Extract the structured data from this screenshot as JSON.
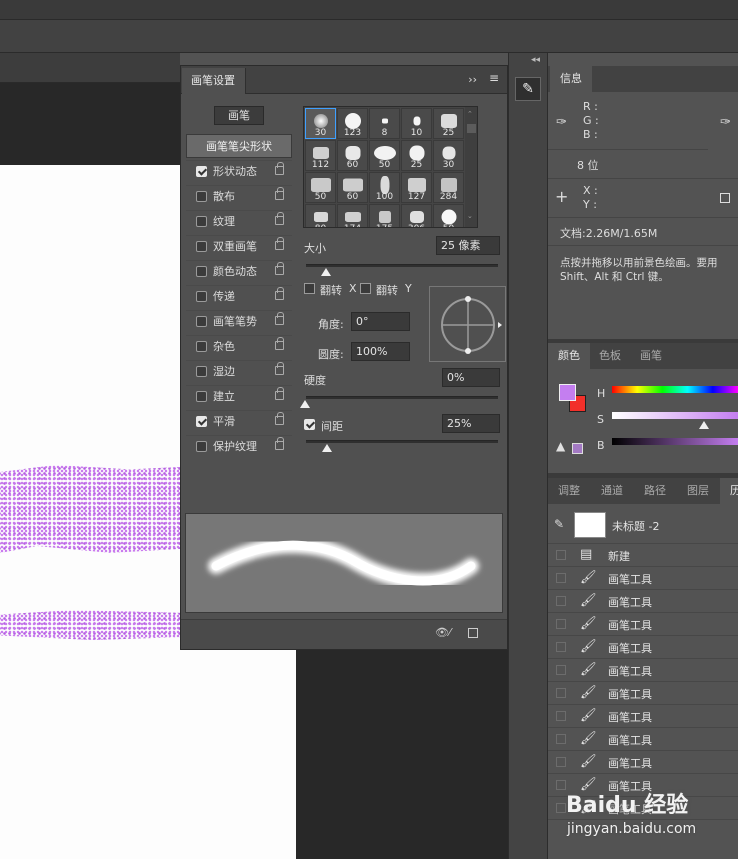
{
  "brush_panel": {
    "tab": "画笔设置",
    "brush_button": "画笔",
    "tip_shape_header": "画笔笔尖形状",
    "options": [
      {
        "label": "形状动态",
        "checked": true
      },
      {
        "label": "散布",
        "checked": false
      },
      {
        "label": "纹理",
        "checked": false
      },
      {
        "label": "双重画笔",
        "checked": false
      },
      {
        "label": "颜色动态",
        "checked": false
      },
      {
        "label": "传递",
        "checked": false
      },
      {
        "label": "画笔笔势",
        "checked": false
      },
      {
        "label": "杂色",
        "checked": false
      },
      {
        "label": "湿边",
        "checked": false
      },
      {
        "label": "建立",
        "checked": false
      },
      {
        "label": "平滑",
        "checked": true
      },
      {
        "label": "保护纹理",
        "checked": false
      }
    ],
    "tips": [
      "30",
      "123",
      "8",
      "10",
      "25",
      "112",
      "60",
      "50",
      "25",
      "30",
      "50",
      "60",
      "100",
      "127",
      "284",
      "80",
      "174",
      "175",
      "306",
      "50"
    ],
    "size_label": "大小",
    "size_value": "25 像素",
    "flip_label": "翻转",
    "flip_x": "X",
    "flip_y": "Y",
    "angle_label": "角度:",
    "angle_value": "0°",
    "roundness_label": "圆度:",
    "roundness_value": "100%",
    "hardness_label": "硬度",
    "hardness_value": "0%",
    "spacing_label": "间距",
    "spacing_value": "25%",
    "spacing_checked": true
  },
  "info": {
    "tab": "信息",
    "r": "R :",
    "g": "G :",
    "b": "B :",
    "bits": "8 位",
    "x": "X :",
    "y": "Y :",
    "doc": "文档:2.26M/1.65M",
    "hint1": "点按并拖移以用前景色绘画。要用",
    "hint2": "Shift、Alt 和 Ctrl 键。"
  },
  "color_panel": {
    "tabs": [
      "颜色",
      "色板",
      "画笔"
    ],
    "h": "H",
    "s": "S",
    "b": "B",
    "fg_color": "#c47ef0",
    "bg_color": "#f2302a"
  },
  "layers_tabs": [
    "调整",
    "通道",
    "路径",
    "图层",
    "历"
  ],
  "history": {
    "snapshot": "未标题 -2",
    "items": [
      "新建",
      "画笔工具",
      "画笔工具",
      "画笔工具",
      "画笔工具",
      "画笔工具",
      "画笔工具",
      "画笔工具",
      "画笔工具",
      "画笔工具",
      "画笔工具",
      "画笔工具"
    ]
  },
  "watermark": {
    "brand": "Baidu 经验",
    "url": "jingyan.baidu.com"
  }
}
